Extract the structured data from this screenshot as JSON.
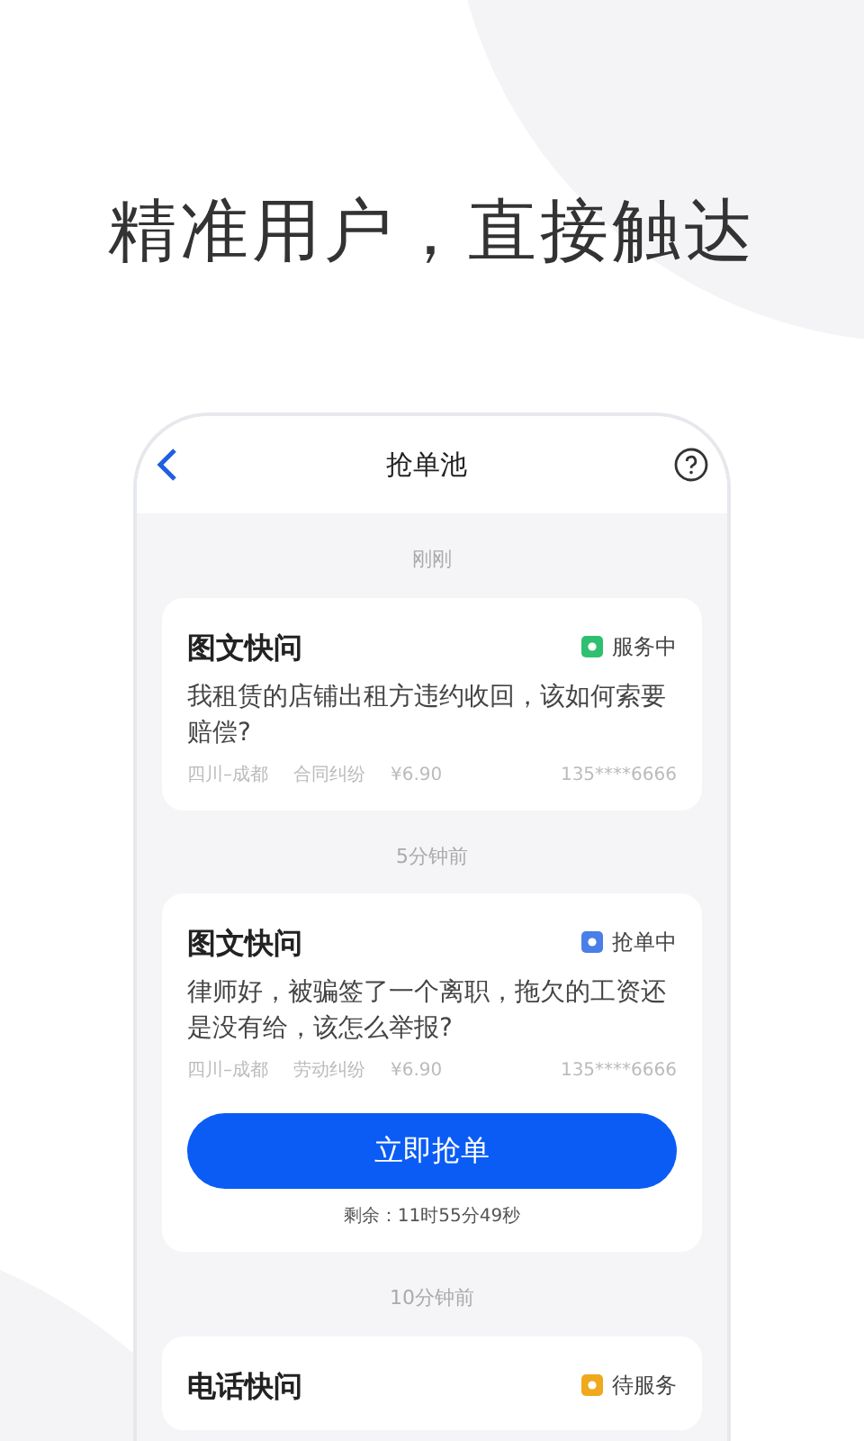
{
  "headline": "精准用户，直接触达",
  "header": {
    "title": "抢单池"
  },
  "groups": [
    {
      "time": "刚刚",
      "card": {
        "type": "图文快问",
        "status": "服务中",
        "color": "#2fbf71",
        "question": "我租赁的店铺出租方违约收回，该如何索要赔偿?",
        "location": "四川–成都",
        "category": "合同纠纷",
        "price": "¥6.90",
        "phone": "135****6666"
      }
    },
    {
      "time": "5分钟前",
      "card": {
        "type": "图文快问",
        "status": "抢单中",
        "color": "#4a7fe8",
        "question": "律师好，被骗签了一个离职，拖欠的工资还是没有给，该怎么举报?",
        "location": "四川–成都",
        "category": "劳动纠纷",
        "price": "¥6.90",
        "phone": "135****6666",
        "action": "立即抢单",
        "remaining": "剩余：11时55分49秒"
      }
    },
    {
      "time": "10分钟前",
      "card": {
        "type": "电话快问",
        "status": "待服务",
        "color": "#f0a81c"
      }
    }
  ]
}
